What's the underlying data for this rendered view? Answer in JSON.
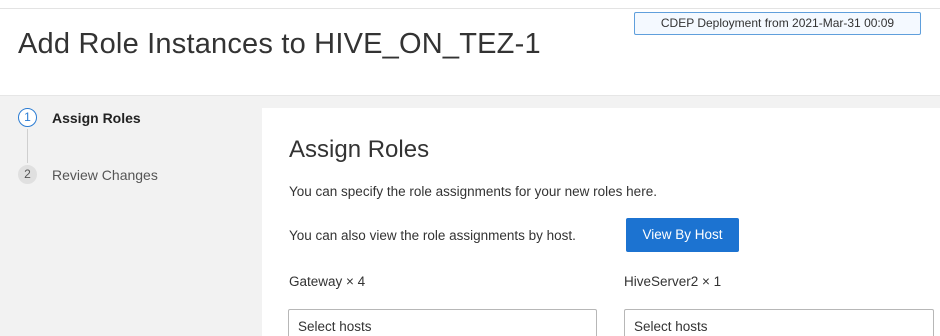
{
  "header": {
    "title": "Add Role Instances to HIVE_ON_TEZ-1",
    "deployment_badge": "CDEP Deployment from 2021-Mar-31 00:09"
  },
  "wizard": {
    "steps": [
      {
        "number": "1",
        "label": "Assign Roles",
        "state": "active"
      },
      {
        "number": "2",
        "label": "Review Changes",
        "state": "inactive"
      }
    ]
  },
  "main": {
    "section_title": "Assign Roles",
    "description_1": "You can specify the role assignments for your new roles here.",
    "description_2": "You can also view the role assignments by host.",
    "view_by_host_label": "View By Host",
    "roles": [
      {
        "label": "Gateway × 4",
        "placeholder": "Select hosts"
      },
      {
        "label": "HiveServer2 × 1",
        "placeholder": "Select hosts"
      }
    ]
  },
  "colors": {
    "accent": "#1c73d1",
    "active_step": "#2b7cd3",
    "sidebar_bg": "#f2f2f2"
  }
}
